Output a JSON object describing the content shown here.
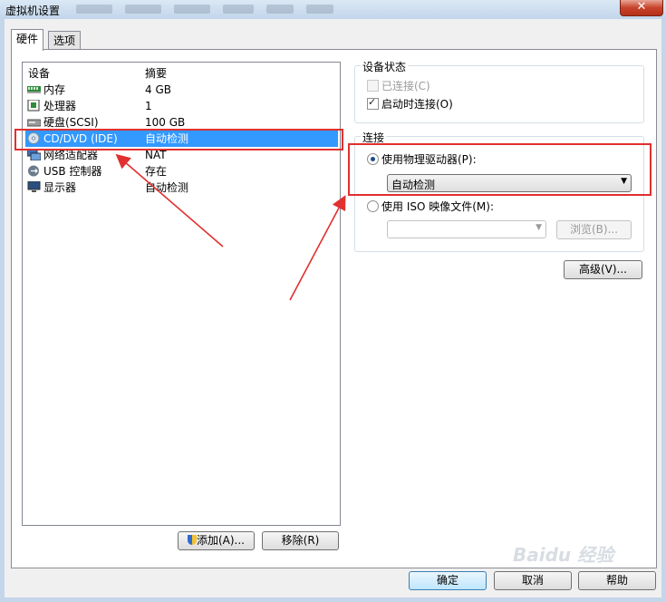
{
  "window": {
    "title": "虚拟机设置",
    "close_label": "✕"
  },
  "tabs": [
    {
      "label": "硬件"
    },
    {
      "label": "选项"
    }
  ],
  "device_list": {
    "col_device": "设备",
    "col_summary": "摘要",
    "rows": [
      {
        "name": "内存",
        "summary": "4 GB",
        "icon": "memory-icon"
      },
      {
        "name": "处理器",
        "summary": "1",
        "icon": "processor-icon"
      },
      {
        "name": "硬盘(SCSI)",
        "summary": "100 GB",
        "icon": "hard-disk-icon"
      },
      {
        "name": "CD/DVD (IDE)",
        "summary": "自动检测",
        "icon": "cd-dvd-icon"
      },
      {
        "name": "网络适配器",
        "summary": "NAT",
        "icon": "network-adapter-icon"
      },
      {
        "name": "USB 控制器",
        "summary": "存在",
        "icon": "usb-icon"
      },
      {
        "name": "显示器",
        "summary": "自动检测",
        "icon": "display-icon"
      }
    ],
    "selected_index": 3
  },
  "list_buttons": {
    "add": "添加(A)...",
    "remove": "移除(R)"
  },
  "device_status": {
    "title": "设备状态",
    "connected_label": "已连接(C)",
    "connected_checked": false,
    "connected_enabled": false,
    "connect_on_power_label": "启动时连接(O)",
    "connect_on_power_checked": true
  },
  "connection": {
    "title": "连接",
    "physical_label": "使用物理驱动器(P):",
    "physical_selected": true,
    "physical_value": "自动检测",
    "iso_label": "使用 ISO 映像文件(M):",
    "iso_selected": false,
    "iso_value": "",
    "browse_label": "浏览(B)..."
  },
  "advanced_button": "高级(V)...",
  "footer": {
    "ok": "确定",
    "cancel": "取消",
    "help": "帮助"
  },
  "watermark": "Baidu 经验",
  "colors": {
    "selection": "#3399ff",
    "annotation": "#e0302f"
  }
}
